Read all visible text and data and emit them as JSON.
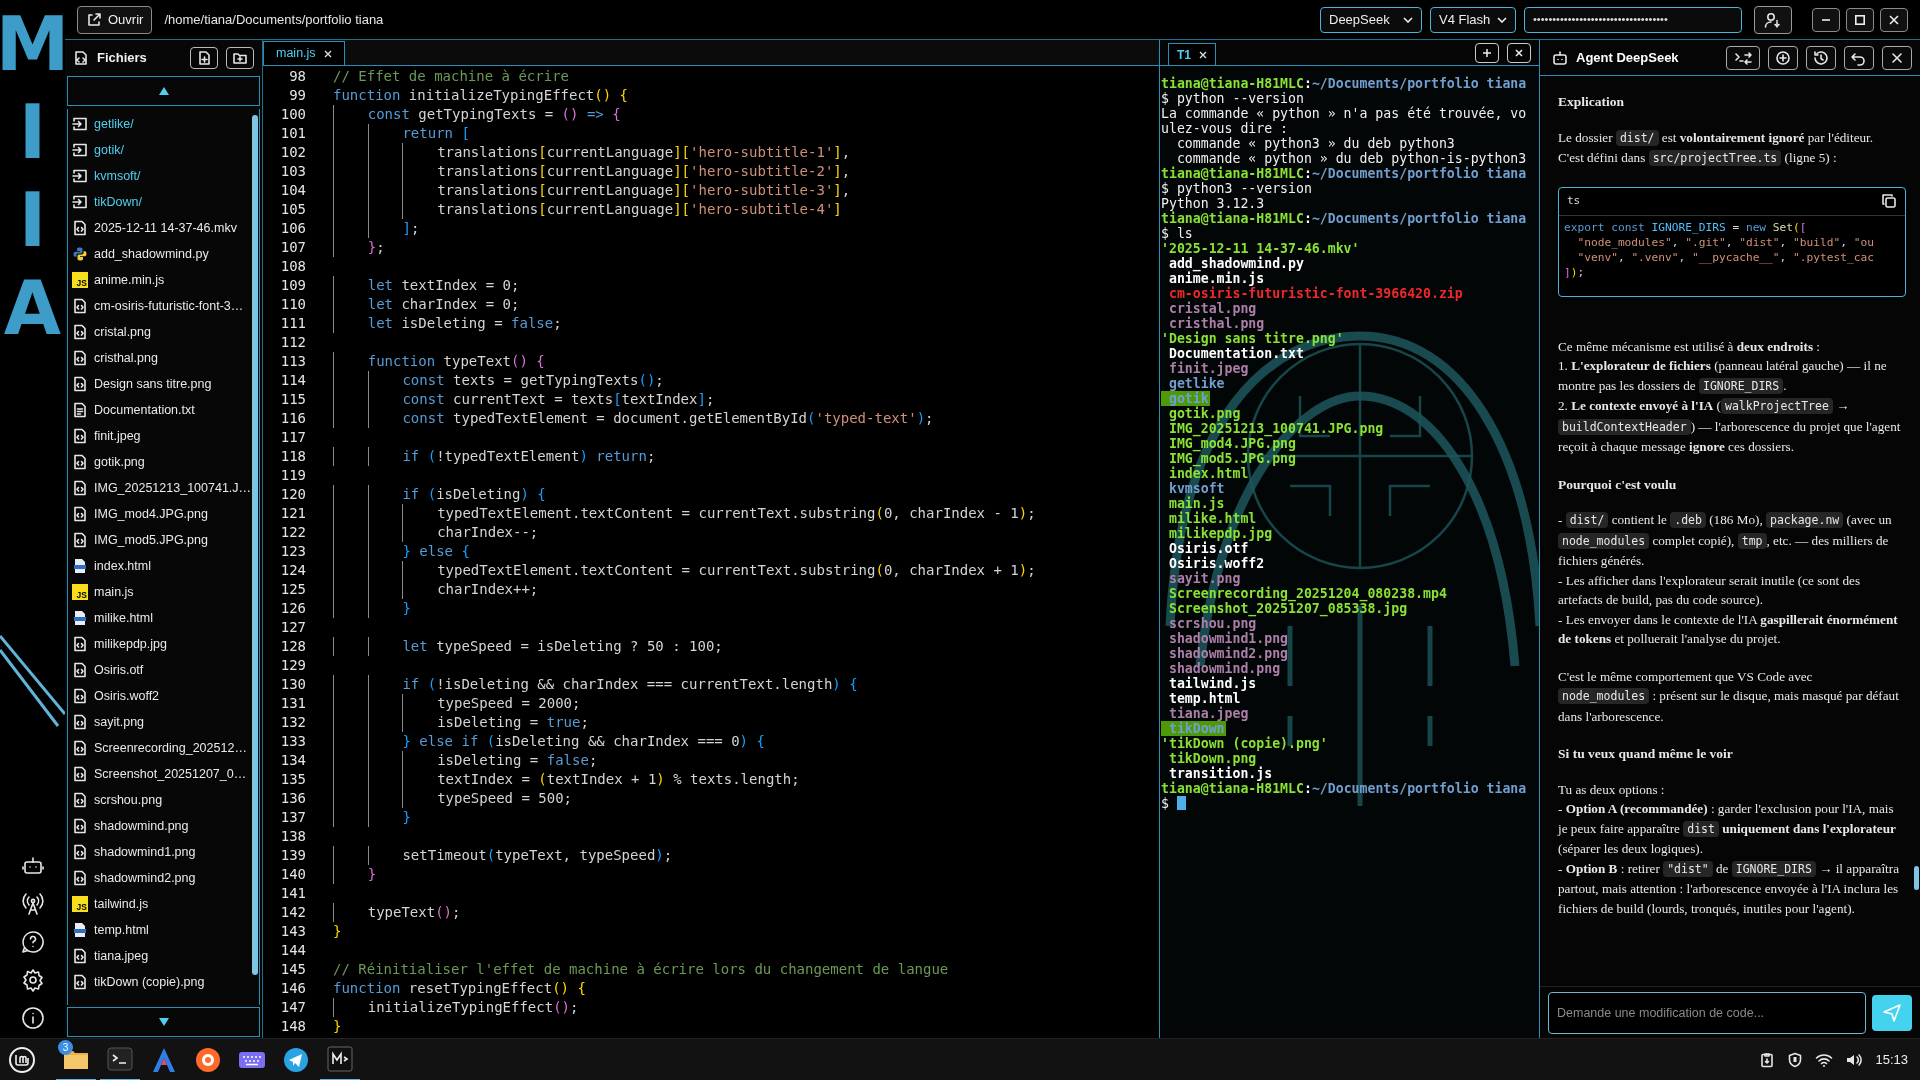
{
  "sidebar": {
    "logo_letters": [
      "M",
      "I",
      "I",
      "A"
    ]
  },
  "toolbar": {
    "open_button": "Ouvrir",
    "path": "/home/tiana/Documents/portfolio tiana",
    "provider": "DeepSeek",
    "model": "V4 Flash",
    "api_key": "•••••••••••••••••••••••••••••••••••"
  },
  "file_panel": {
    "title": "Fichiers",
    "items": [
      {
        "name": "getlike/",
        "kind": "folder"
      },
      {
        "name": "gotik/",
        "kind": "folder"
      },
      {
        "name": "kvmsoft/",
        "kind": "folder"
      },
      {
        "name": "tikDown/",
        "kind": "folder"
      },
      {
        "name": "2025-12-11 14-37-46.mkv",
        "kind": "file"
      },
      {
        "name": "add_shadowmind.py",
        "kind": "python"
      },
      {
        "name": "anime.min.js",
        "kind": "js",
        "icon_label": "JS"
      },
      {
        "name": "cm-osiris-futuristic-font-3…",
        "kind": "file"
      },
      {
        "name": "cristal.png",
        "kind": "file"
      },
      {
        "name": "cristhal.png",
        "kind": "file"
      },
      {
        "name": "Design sans titre.png",
        "kind": "file"
      },
      {
        "name": "Documentation.txt",
        "kind": "text"
      },
      {
        "name": "finit.jpeg",
        "kind": "file"
      },
      {
        "name": "gotik.png",
        "kind": "file"
      },
      {
        "name": "IMG_20251213_100741.J…",
        "kind": "file"
      },
      {
        "name": "IMG_mod4.JPG.png",
        "kind": "file"
      },
      {
        "name": "IMG_mod5.JPG.png",
        "kind": "file"
      },
      {
        "name": "index.html",
        "kind": "html"
      },
      {
        "name": "main.js",
        "kind": "js",
        "icon_label": "JS"
      },
      {
        "name": "milike.html",
        "kind": "html"
      },
      {
        "name": "milikepdp.jpg",
        "kind": "file"
      },
      {
        "name": "Osiris.otf",
        "kind": "file"
      },
      {
        "name": "Osiris.woff2",
        "kind": "file"
      },
      {
        "name": "sayit.png",
        "kind": "file"
      },
      {
        "name": "Screenrecording_202512…",
        "kind": "file"
      },
      {
        "name": "Screenshot_20251207_0…",
        "kind": "file"
      },
      {
        "name": "scrshou.png",
        "kind": "file"
      },
      {
        "name": "shadowmind.png",
        "kind": "file"
      },
      {
        "name": "shadowmind1.png",
        "kind": "file"
      },
      {
        "name": "shadowmind2.png",
        "kind": "file"
      },
      {
        "name": "tailwind.js",
        "kind": "js",
        "icon_label": "JS"
      },
      {
        "name": "temp.html",
        "kind": "html"
      },
      {
        "name": "tiana.jpeg",
        "kind": "file"
      },
      {
        "name": "tikDown (copie).png",
        "kind": "file"
      }
    ]
  },
  "editor": {
    "tabs": [
      {
        "label": "main.js",
        "selected": true
      }
    ],
    "lines": [
      {
        "n": "98",
        "tokens": [
          {
            "kind": "comment",
            "text": "// Effet de machine à écrire"
          }
        ]
      },
      {
        "n": "99",
        "tokens": [
          {
            "kind": "keyword",
            "text": "function"
          },
          {
            "kind": "plain",
            "text": " initializeTypingEffect"
          },
          {
            "kind": "bracket_gold",
            "text": "()"
          },
          {
            "kind": "bracket_gold",
            "text": " {"
          }
        ]
      },
      {
        "n": "100",
        "tokens": [
          {
            "kind": "keyword",
            "text": "    const"
          },
          {
            "kind": "plain",
            "text": " getTypingTexts = "
          },
          {
            "kind": "bracket_violet",
            "text": "()"
          },
          {
            "kind": "keyword",
            "text": " =>"
          },
          {
            "kind": "bracket_violet",
            "text": " {"
          }
        ]
      },
      {
        "n": "101",
        "tokens": [
          {
            "kind": "keyword",
            "text": "        return"
          },
          {
            "kind": "bracket_blue",
            "text": " ["
          }
        ]
      },
      {
        "n": "102",
        "tokens": [
          {
            "kind": "plain",
            "text": "            translations"
          },
          {
            "kind": "bracket_gold",
            "text": "["
          },
          {
            "kind": "plain",
            "text": "currentLanguage"
          },
          {
            "kind": "bracket_gold",
            "text": "]["
          },
          {
            "kind": "string",
            "text": "'hero-subtitle-1'"
          },
          {
            "kind": "bracket_gold",
            "text": "]"
          },
          {
            "kind": "plain",
            "text": ","
          }
        ]
      },
      {
        "n": "103",
        "tokens": [
          {
            "kind": "plain",
            "text": "            translations"
          },
          {
            "kind": "bracket_gold",
            "text": "["
          },
          {
            "kind": "plain",
            "text": "currentLanguage"
          },
          {
            "kind": "bracket_gold",
            "text": "]["
          },
          {
            "kind": "string",
            "text": "'hero-subtitle-2'"
          },
          {
            "kind": "bracket_gold",
            "text": "]"
          },
          {
            "kind": "plain",
            "text": ","
          }
        ]
      },
      {
        "n": "104",
        "tokens": [
          {
            "kind": "plain",
            "text": "            translations"
          },
          {
            "kind": "bracket_gold",
            "text": "["
          },
          {
            "kind": "plain",
            "text": "currentLanguage"
          },
          {
            "kind": "bracket_gold",
            "text": "]["
          },
          {
            "kind": "string",
            "text": "'hero-subtitle-3'"
          },
          {
            "kind": "bracket_gold",
            "text": "]"
          },
          {
            "kind": "plain",
            "text": ","
          }
        ]
      },
      {
        "n": "105",
        "tokens": [
          {
            "kind": "plain",
            "text": "            translations"
          },
          {
            "kind": "bracket_gold",
            "text": "["
          },
          {
            "kind": "plain",
            "text": "currentLanguage"
          },
          {
            "kind": "bracket_gold",
            "text": "]["
          },
          {
            "kind": "string",
            "text": "'hero-subtitle-4'"
          },
          {
            "kind": "bracket_gold",
            "text": "]"
          }
        ]
      },
      {
        "n": "106",
        "tokens": [
          {
            "kind": "bracket_blue",
            "text": "        ]"
          },
          {
            "kind": "plain",
            "text": ";"
          }
        ]
      },
      {
        "n": "107",
        "tokens": [
          {
            "kind": "bracket_violet",
            "text": "    }"
          },
          {
            "kind": "plain",
            "text": ";"
          }
        ]
      },
      {
        "n": "108"
      },
      {
        "n": "109",
        "tokens": [
          {
            "kind": "keyword",
            "text": "    let"
          },
          {
            "kind": "plain",
            "text": " textIndex = 0;"
          }
        ]
      },
      {
        "n": "110",
        "tokens": [
          {
            "kind": "keyword",
            "text": "    let"
          },
          {
            "kind": "plain",
            "text": " charIndex = 0;"
          }
        ]
      },
      {
        "n": "111",
        "tokens": [
          {
            "kind": "keyword",
            "text": "    let"
          },
          {
            "kind": "plain",
            "text": " isDeleting = "
          },
          {
            "kind": "keyword",
            "text": "false"
          },
          {
            "kind": "plain",
            "text": ";"
          }
        ]
      },
      {
        "n": "112"
      },
      {
        "n": "113",
        "tokens": [
          {
            "kind": "keyword",
            "text": "    function"
          },
          {
            "kind": "plain",
            "text": " typeText"
          },
          {
            "kind": "bracket_violet",
            "text": "()"
          },
          {
            "kind": "bracket_violet",
            "text": " {"
          }
        ]
      },
      {
        "n": "114",
        "tokens": [
          {
            "kind": "keyword",
            "text": "        const"
          },
          {
            "kind": "plain",
            "text": " texts = getTypingTexts"
          },
          {
            "kind": "bracket_blue",
            "text": "()"
          },
          {
            "kind": "plain",
            "text": ";"
          }
        ]
      },
      {
        "n": "115",
        "tokens": [
          {
            "kind": "keyword",
            "text": "        const"
          },
          {
            "kind": "plain",
            "text": " currentText = texts"
          },
          {
            "kind": "bracket_blue",
            "text": "["
          },
          {
            "kind": "plain",
            "text": "textIndex"
          },
          {
            "kind": "bracket_blue",
            "text": "]"
          },
          {
            "kind": "plain",
            "text": ";"
          }
        ]
      },
      {
        "n": "116",
        "tokens": [
          {
            "kind": "keyword",
            "text": "        const"
          },
          {
            "kind": "plain",
            "text": " typedTextElement = document.getElementById"
          },
          {
            "kind": "bracket_blue",
            "text": "("
          },
          {
            "kind": "string",
            "text": "'typed-text'"
          },
          {
            "kind": "bracket_blue",
            "text": ")"
          },
          {
            "kind": "plain",
            "text": ";"
          }
        ]
      },
      {
        "n": "117"
      },
      {
        "n": "118",
        "tokens": [
          {
            "kind": "keyword",
            "text": "        if"
          },
          {
            "kind": "bracket_blue",
            "text": " ("
          },
          {
            "kind": "plain",
            "text": "!typedTextElement"
          },
          {
            "kind": "bracket_blue",
            "text": ")"
          },
          {
            "kind": "keyword",
            "text": " return"
          },
          {
            "kind": "plain",
            "text": ";"
          }
        ]
      },
      {
        "n": "119"
      },
      {
        "n": "120",
        "tokens": [
          {
            "kind": "keyword",
            "text": "        if"
          },
          {
            "kind": "bracket_blue",
            "text": " ("
          },
          {
            "kind": "plain",
            "text": "isDeleting"
          },
          {
            "kind": "bracket_blue",
            "text": ")"
          },
          {
            "kind": "bracket_blue",
            "text": " {"
          }
        ]
      },
      {
        "n": "121",
        "tokens": [
          {
            "kind": "plain",
            "text": "            typedTextElement.textContent = currentText.substring"
          },
          {
            "kind": "bracket_gold",
            "text": "("
          },
          {
            "kind": "plain",
            "text": "0, charIndex - 1"
          },
          {
            "kind": "bracket_gold",
            "text": ")"
          },
          {
            "kind": "plain",
            "text": ";"
          }
        ]
      },
      {
        "n": "122",
        "tokens": [
          {
            "kind": "plain",
            "text": "            charIndex--;"
          }
        ]
      },
      {
        "n": "123",
        "tokens": [
          {
            "kind": "bracket_blue",
            "text": "        }"
          },
          {
            "kind": "keyword",
            "text": " else"
          },
          {
            "kind": "bracket_blue",
            "text": " {"
          }
        ]
      },
      {
        "n": "124",
        "tokens": [
          {
            "kind": "plain",
            "text": "            typedTextElement.textContent = currentText.substring"
          },
          {
            "kind": "bracket_gold",
            "text": "("
          },
          {
            "kind": "plain",
            "text": "0, charIndex + 1"
          },
          {
            "kind": "bracket_gold",
            "text": ")"
          },
          {
            "kind": "plain",
            "text": ";"
          }
        ]
      },
      {
        "n": "125",
        "tokens": [
          {
            "kind": "plain",
            "text": "            charIndex++;"
          }
        ]
      },
      {
        "n": "126",
        "tokens": [
          {
            "kind": "bracket_blue",
            "text": "        }"
          }
        ]
      },
      {
        "n": "127"
      },
      {
        "n": "128",
        "tokens": [
          {
            "kind": "keyword",
            "text": "        let"
          },
          {
            "kind": "plain",
            "text": " typeSpeed = isDeleting ? 50 : 100;"
          }
        ]
      },
      {
        "n": "129"
      },
      {
        "n": "130",
        "tokens": [
          {
            "kind": "keyword",
            "text": "        if"
          },
          {
            "kind": "bracket_blue",
            "text": " ("
          },
          {
            "kind": "plain",
            "text": "!isDeleting && charIndex === currentText.length"
          },
          {
            "kind": "bracket_blue",
            "text": ")"
          },
          {
            "kind": "bracket_blue",
            "text": " {"
          }
        ]
      },
      {
        "n": "131",
        "tokens": [
          {
            "kind": "plain",
            "text": "            typeSpeed = 2000;"
          }
        ]
      },
      {
        "n": "132",
        "tokens": [
          {
            "kind": "plain",
            "text": "            isDeleting = "
          },
          {
            "kind": "keyword",
            "text": "true"
          },
          {
            "kind": "plain",
            "text": ";"
          }
        ]
      },
      {
        "n": "133",
        "tokens": [
          {
            "kind": "bracket_blue",
            "text": "        }"
          },
          {
            "kind": "keyword",
            "text": " else if"
          },
          {
            "kind": "bracket_blue",
            "text": " ("
          },
          {
            "kind": "plain",
            "text": "isDeleting && charIndex === 0"
          },
          {
            "kind": "bracket_blue",
            "text": ")"
          },
          {
            "kind": "bracket_blue",
            "text": " {"
          }
        ]
      },
      {
        "n": "134",
        "tokens": [
          {
            "kind": "plain",
            "text": "            isDeleting = "
          },
          {
            "kind": "keyword",
            "text": "false"
          },
          {
            "kind": "plain",
            "text": ";"
          }
        ]
      },
      {
        "n": "135",
        "tokens": [
          {
            "kind": "plain",
            "text": "            textIndex = "
          },
          {
            "kind": "bracket_gold",
            "text": "("
          },
          {
            "kind": "plain",
            "text": "textIndex + 1"
          },
          {
            "kind": "bracket_gold",
            "text": ")"
          },
          {
            "kind": "plain",
            "text": " % texts.length;"
          }
        ]
      },
      {
        "n": "136",
        "tokens": [
          {
            "kind": "plain",
            "text": "            typeSpeed = 500;"
          }
        ]
      },
      {
        "n": "137",
        "tokens": [
          {
            "kind": "bracket_blue",
            "text": "        }"
          }
        ]
      },
      {
        "n": "138"
      },
      {
        "n": "139",
        "tokens": [
          {
            "kind": "plain",
            "text": "        setTimeout"
          },
          {
            "kind": "bracket_blue",
            "text": "("
          },
          {
            "kind": "plain",
            "text": "typeText, typeSpeed"
          },
          {
            "kind": "bracket_blue",
            "text": ")"
          },
          {
            "kind": "plain",
            "text": ";"
          }
        ]
      },
      {
        "n": "140",
        "tokens": [
          {
            "kind": "bracket_violet",
            "text": "    }"
          }
        ]
      },
      {
        "n": "141"
      },
      {
        "n": "142",
        "tokens": [
          {
            "kind": "plain",
            "text": "    typeText"
          },
          {
            "kind": "bracket_violet",
            "text": "()"
          },
          {
            "kind": "plain",
            "text": ";"
          }
        ]
      },
      {
        "n": "143",
        "tokens": [
          {
            "kind": "bracket_gold",
            "text": "}"
          }
        ]
      },
      {
        "n": "144"
      },
      {
        "n": "145",
        "tokens": [
          {
            "kind": "comment",
            "text": "// Réinitialiser l'effet de machine à écrire lors du changement de langue"
          }
        ]
      },
      {
        "n": "146",
        "tokens": [
          {
            "kind": "keyword",
            "text": "function"
          },
          {
            "kind": "plain",
            "text": " resetTypingEffect"
          },
          {
            "kind": "bracket_gold",
            "text": "()"
          },
          {
            "kind": "bracket_gold",
            "text": " {"
          }
        ]
      },
      {
        "n": "147",
        "tokens": [
          {
            "kind": "plain",
            "text": "    initializeTypingEffect"
          },
          {
            "kind": "bracket_violet",
            "text": "()"
          },
          {
            "kind": "plain",
            "text": ";"
          }
        ]
      },
      {
        "n": "148",
        "tokens": [
          {
            "kind": "bracket_gold",
            "text": "}"
          }
        ]
      }
    ]
  },
  "terminal": {
    "tabs": [
      {
        "label": "T1",
        "selected": true
      }
    ],
    "lines": [
      {
        "kind": "prompt",
        "user": "tiana@tiana-H81MLC",
        "sep": ":",
        "path": "~/Documents/portfolio tiana"
      },
      {
        "kind": "command",
        "text": "$ python --version"
      },
      {
        "kind": "output",
        "text": "La commande « python » n'a pas été trouvée, vo"
      },
      {
        "kind": "output",
        "text": "ulez-vous dire :"
      },
      {
        "kind": "output",
        "text": "  commande « python3 » du deb python3"
      },
      {
        "kind": "output",
        "text": "  commande « python » du deb python-is-python3"
      },
      {
        "kind": "prompt",
        "user": "tiana@tiana-H81MLC",
        "sep": ":",
        "path": "~/Documents/portfolio tiana"
      },
      {
        "kind": "command",
        "text": "$ python3 --version"
      },
      {
        "kind": "output",
        "text": "Python 3.12.3"
      },
      {
        "kind": "prompt",
        "user": "tiana@tiana-H81MLC",
        "sep": ":",
        "path": "~/Documents/portfolio tiana"
      },
      {
        "kind": "command",
        "text": "$ ls"
      },
      {
        "kind": "entry",
        "text": "'2025-12-11 14-37-46.mkv'",
        "color": "#8ae234",
        "highlighted": false
      },
      {
        "kind": "entry",
        "text": " add_shadowmind.py",
        "color": "#ffffff",
        "highlighted": false
      },
      {
        "kind": "entry",
        "text": " anime.min.js",
        "color": "#ffffff",
        "highlighted": false
      },
      {
        "kind": "entry",
        "text": " cm-osiris-futuristic-font-3966420.zip",
        "color": "#ef2929",
        "highlighted": false
      },
      {
        "kind": "entry",
        "text": " cristal.png",
        "color": "#ad7fa8",
        "highlighted": false
      },
      {
        "kind": "entry",
        "text": " cristhal.png",
        "color": "#ad7fa8",
        "highlighted": false
      },
      {
        "kind": "entry",
        "text": "'Design sans titre.png'",
        "color": "#8ae234",
        "highlighted": false
      },
      {
        "kind": "entry",
        "text": " Documentation.txt",
        "color": "#ffffff",
        "highlighted": false
      },
      {
        "kind": "entry",
        "text": " finit.jpeg",
        "color": "#ad7fa8",
        "highlighted": false
      },
      {
        "kind": "entry",
        "text": " getlike",
        "color": "#729fcf",
        "highlighted": false
      },
      {
        "kind": "entry",
        "text": " gotik",
        "highlighted": true
      },
      {
        "kind": "entry",
        "text": " gotik.png",
        "color": "#8ae234",
        "highlighted": false
      },
      {
        "kind": "entry",
        "text": " IMG_20251213_100741.JPG.png",
        "color": "#8ae234",
        "highlighted": false
      },
      {
        "kind": "entry",
        "text": " IMG_mod4.JPG.png",
        "color": "#8ae234",
        "highlighted": false
      },
      {
        "kind": "entry",
        "text": " IMG_mod5.JPG.png",
        "color": "#8ae234",
        "highlighted": false
      },
      {
        "kind": "entry",
        "text": " index.html",
        "color": "#8ae234",
        "highlighted": false
      },
      {
        "kind": "entry",
        "text": " kvmsoft",
        "color": "#729fcf",
        "highlighted": false
      },
      {
        "kind": "entry",
        "text": " main.js",
        "color": "#8ae234",
        "highlighted": false
      },
      {
        "kind": "entry",
        "text": " milike.html",
        "color": "#8ae234",
        "highlighted": false
      },
      {
        "kind": "entry",
        "text": " milikepdp.jpg",
        "color": "#8ae234",
        "highlighted": false
      },
      {
        "kind": "entry",
        "text": " Osiris.otf",
        "color": "#ffffff",
        "highlighted": false
      },
      {
        "kind": "entry",
        "text": " Osiris.woff2",
        "color": "#ffffff",
        "highlighted": false
      },
      {
        "kind": "entry",
        "text": " sayit.png",
        "color": "#ad7fa8",
        "highlighted": false
      },
      {
        "kind": "entry",
        "text": " Screenrecording_20251204_080238.mp4",
        "color": "#8ae234",
        "highlighted": false
      },
      {
        "kind": "entry",
        "text": " Screenshot_20251207_085338.jpg",
        "color": "#8ae234",
        "highlighted": false
      },
      {
        "kind": "entry",
        "text": " scrshou.png",
        "color": "#ad7fa8",
        "highlighted": false
      },
      {
        "kind": "entry",
        "text": " shadowmind1.png",
        "color": "#ad7fa8",
        "highlighted": false
      },
      {
        "kind": "entry",
        "text": " shadowmind2.png",
        "color": "#ad7fa8",
        "highlighted": false
      },
      {
        "kind": "entry",
        "text": " shadowmind.png",
        "color": "#ad7fa8",
        "highlighted": false
      },
      {
        "kind": "entry",
        "text": " tailwind.js",
        "color": "#ffffff",
        "highlighted": false
      },
      {
        "kind": "entry",
        "text": " temp.html",
        "color": "#ffffff",
        "highlighted": false
      },
      {
        "kind": "entry",
        "text": " tiana.jpeg",
        "color": "#ad7fa8",
        "highlighted": false
      },
      {
        "kind": "entry",
        "text": " tikDown",
        "highlighted": true
      },
      {
        "kind": "entry",
        "text": "'tikDown (copie).png'",
        "color": "#8ae234",
        "highlighted": false
      },
      {
        "kind": "entry",
        "text": " tikDown.png",
        "color": "#8ae234",
        "highlighted": false
      },
      {
        "kind": "entry",
        "text": " transition.js",
        "color": "#ffffff",
        "highlighted": false
      },
      {
        "kind": "prompt",
        "user": "tiana@tiana-H81MLC",
        "sep": ":",
        "path": "~/Documents/portfolio tiana"
      },
      {
        "kind": "command",
        "text": "$",
        "cursor": true
      }
    ]
  },
  "agent": {
    "title": "Agent DeepSeek",
    "blocks": [
      {
        "kind": "heading",
        "text": "Explication"
      },
      {
        "kind": "paragraph",
        "lines": [
          [
            "Le dossier ",
            {
              "code": "dist/"
            },
            " est **volontairement ignoré** par l'éditeur."
          ],
          [
            "C'est défini dans ",
            {
              "code": "src/projectTree.ts"
            },
            " (ligne 5) :"
          ]
        ]
      },
      {
        "kind": "code",
        "language": "ts",
        "lines": [
          [
            {
              "kind": "keyword",
              "text": "export"
            },
            {
              "kind": "keyword",
              "text": " const"
            },
            {
              "kind": "constant",
              "text": " IGNORE_DIRS"
            },
            {
              "kind": "plain",
              "text": " ="
            },
            {
              "kind": "keyword",
              "text": " new"
            },
            {
              "kind": "function_name",
              "text": " Set"
            },
            {
              "kind": "bracket_gold",
              "text": "("
            },
            {
              "kind": "bracket_violet",
              "text": "["
            }
          ],
          [
            {
              "kind": "string",
              "text": "  \"node_modules\""
            },
            {
              "kind": "plain",
              "text": ", "
            },
            {
              "kind": "string",
              "text": "\".git\""
            },
            {
              "kind": "plain",
              "text": ", "
            },
            {
              "kind": "string",
              "text": "\"dist\""
            },
            {
              "kind": "plain",
              "text": ", "
            },
            {
              "kind": "string",
              "text": "\"build\""
            },
            {
              "kind": "plain",
              "text": ", "
            },
            {
              "kind": "string",
              "text": "\"ou"
            }
          ],
          [
            {
              "kind": "string",
              "text": "  \"venv\""
            },
            {
              "kind": "plain",
              "text": ", "
            },
            {
              "kind": "string",
              "text": "\".venv\""
            },
            {
              "kind": "plain",
              "text": ", "
            },
            {
              "kind": "string",
              "text": "\"__pycache__\""
            },
            {
              "kind": "plain",
              "text": ", "
            },
            {
              "kind": "string",
              "text": "\".pytest_cac"
            }
          ],
          [
            {
              "kind": "bracket_violet",
              "text": "]"
            },
            {
              "kind": "bracket_gold",
              "text": ")"
            },
            {
              "kind": "plain",
              "text": ";"
            }
          ]
        ]
      },
      {
        "kind": "paragraph",
        "lines": [
          [
            "Ce même mécanisme est utilisé à **deux endroits** :"
          ],
          [
            "1. **L'explorateur de fichiers** (panneau latéral gauche) — il ne montre pas les dossiers de ",
            {
              "code": "IGNORE_DIRS"
            },
            "."
          ],
          [
            "2. **Le contexte envoyé à l'IA** (",
            {
              "code": "walkProjectTree"
            },
            " → ",
            {
              "code": "buildContextHeader"
            },
            ") — l'arborescence du projet que l'agent reçoit à chaque message **ignore** ces dossiers."
          ]
        ]
      },
      {
        "kind": "heading",
        "text": "Pourquoi c'est voulu"
      },
      {
        "kind": "paragraph",
        "lines": [
          [
            "- ",
            {
              "code": "dist/"
            },
            " contient le ",
            {
              "code": ".deb"
            },
            " (186 Mo), ",
            {
              "code": "package.nw"
            },
            " (avec un ",
            {
              "code": "node_modules"
            },
            " complet copié), ",
            {
              "code": "tmp"
            },
            ", etc. — des milliers de fichiers générés."
          ],
          [
            "- Les afficher dans l'explorateur serait inutile (ce sont des artefacts de build, pas du code source)."
          ],
          [
            "- Les envoyer dans le contexte de l'IA **gaspillerait énormément de tokens** et polluerait l'analyse du projet."
          ]
        ]
      },
      {
        "kind": "paragraph",
        "lines": [
          [
            "C'est le même comportement que VS Code avec ",
            {
              "code": "node_modules"
            },
            " : présent sur le disque, mais masqué par défaut dans l'arborescence."
          ]
        ]
      },
      {
        "kind": "heading",
        "text": "Si tu veux quand même le voir"
      },
      {
        "kind": "paragraph",
        "lines": [
          [
            "Tu as deux options :"
          ],
          [
            "- **Option A (recommandée)** : garder l'exclusion pour l'IA, mais je peux faire apparaître ",
            {
              "code": "dist"
            },
            " **uniquement dans l'explorateur** (séparer les deux logiques)."
          ],
          [
            "- **Option B** : retirer ",
            {
              "code": "\"dist\""
            },
            " de ",
            {
              "code": "IGNORE_DIRS"
            },
            " → il apparaîtra partout, mais attention : l'arborescence envoyée à l'IA inclura les fichiers de build (lourds, tronqués, inutiles pour l'agent)."
          ]
        ]
      }
    ],
    "input": {
      "placeholder": "Demande une modification de code..."
    }
  },
  "taskbar": {
    "files_badge": "3",
    "clock": "15:13"
  }
}
